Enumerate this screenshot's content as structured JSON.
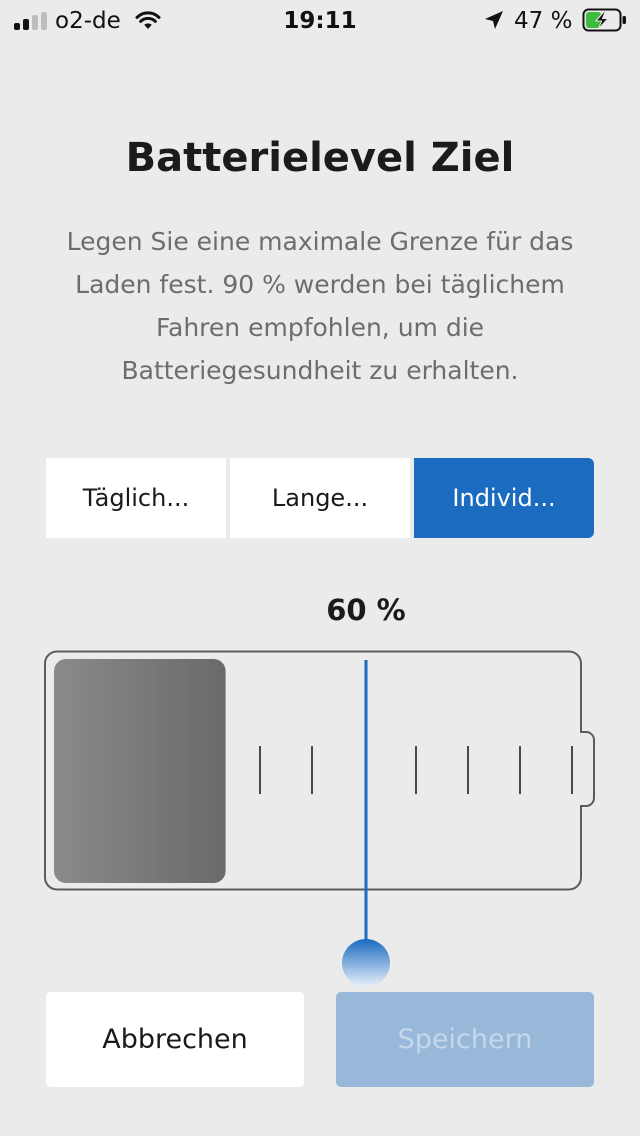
{
  "status_bar": {
    "carrier": "o2-de",
    "time": "19:11",
    "battery_percent": "47 %",
    "signal_bars_active": 2,
    "signal_bars_total": 4,
    "icons": [
      "signal-icon",
      "wifi-icon",
      "location-arrow-icon",
      "battery-charging-icon"
    ],
    "battery_fill_fraction": 0.47,
    "battery_charging": true,
    "colors": {
      "charge": "#3dbb3d"
    }
  },
  "screen": {
    "title": "Batterielevel Ziel",
    "description": "Legen Sie eine maximale Grenze für das Laden fest. 90 % werden bei täglichem Fahren empfohlen, um die Batteriegesundheit zu erhalten."
  },
  "modes": {
    "selected_index": 2,
    "options": [
      {
        "label": "Täglich..."
      },
      {
        "label": "Lange..."
      },
      {
        "label": "Individ..."
      }
    ]
  },
  "charge_target": {
    "label": "60 %",
    "target_percent": 60,
    "current_charge_percent": 33,
    "tick_count": 7,
    "colors": {
      "fill_start": "#8a8a8a",
      "fill_end": "#6a6a6a",
      "slider": "#1b6bc1",
      "outline": "#5c5c5c"
    }
  },
  "actions": {
    "cancel_label": "Abbrechen",
    "save_label": "Speichern",
    "save_enabled": false
  },
  "colors": {
    "accent": "#1b6bc1",
    "background": "#ebebeb",
    "save_disabled_bg": "#98b8da",
    "save_disabled_text": "#c4d7eb"
  }
}
